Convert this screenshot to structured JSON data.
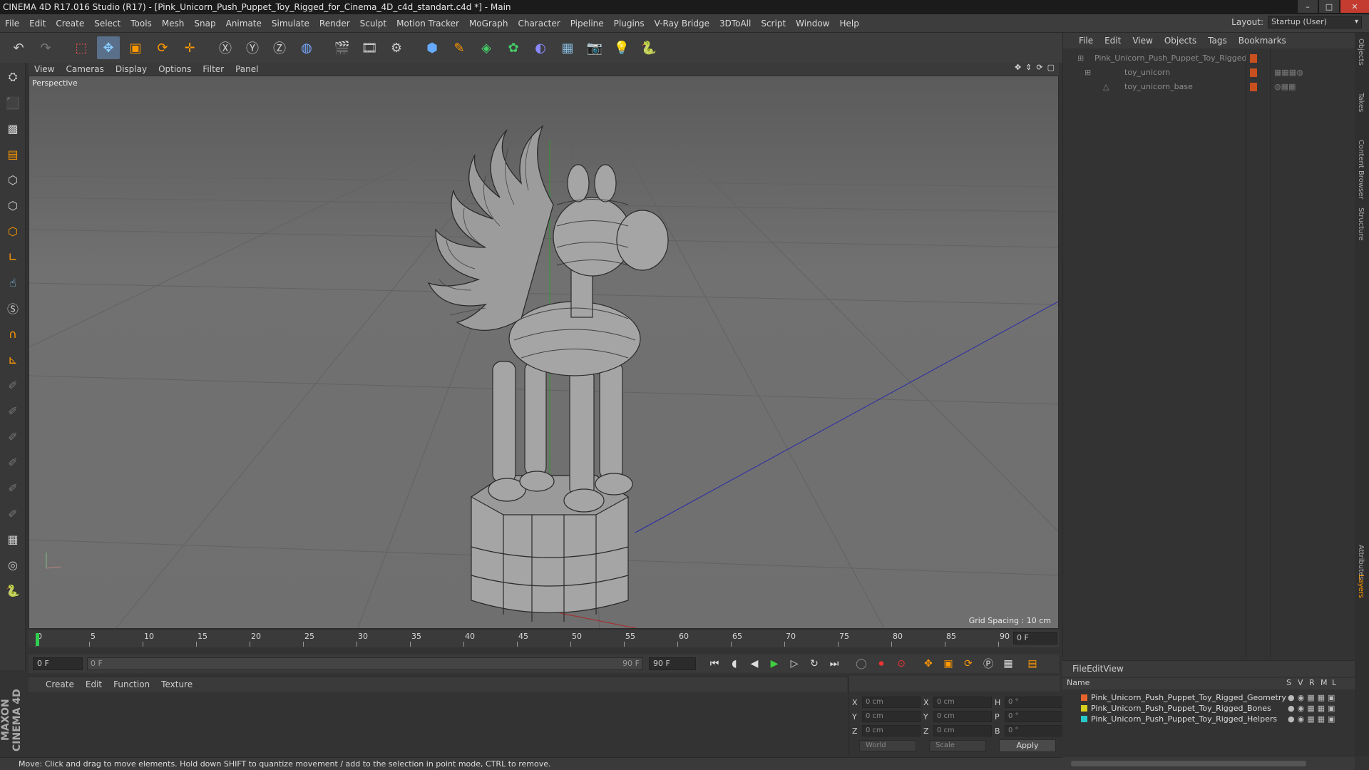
{
  "title": "CINEMA 4D R17.016 Studio (R17) - [Pink_Unicorn_Push_Puppet_Toy_Rigged_for_Cinema_4D_c4d_standart.c4d *] - Main",
  "menu": [
    "File",
    "Edit",
    "Create",
    "Select",
    "Tools",
    "Mesh",
    "Snap",
    "Animate",
    "Simulate",
    "Render",
    "Sculpt",
    "Motion Tracker",
    "MoGraph",
    "Character",
    "Pipeline",
    "Plugins",
    "V-Ray Bridge",
    "3DToAll",
    "Script",
    "Window",
    "Help"
  ],
  "layout_label": "Layout:",
  "layout_value": "Startup (User)",
  "viewport_menu": [
    "View",
    "Cameras",
    "Display",
    "Options",
    "Filter",
    "Panel"
  ],
  "viewport_label": "Perspective",
  "grid_spacing": "Grid Spacing : 10 cm",
  "timeline_ticks": [
    "0",
    "5",
    "10",
    "15",
    "20",
    "25",
    "30",
    "35",
    "40",
    "45",
    "50",
    "55",
    "60",
    "65",
    "70",
    "75",
    "80",
    "85",
    "90"
  ],
  "current_frame": "0 F",
  "start_frame": "0 F",
  "slider_start": "0 F",
  "slider_end": "90 F",
  "end_frame": "90 F",
  "material_menu": [
    "Create",
    "Edit",
    "Function",
    "Texture"
  ],
  "coords": {
    "col1": [
      {
        "label": "X",
        "value": "0 cm"
      },
      {
        "label": "Y",
        "value": "0 cm"
      },
      {
        "label": "Z",
        "value": "0 cm"
      }
    ],
    "col2": [
      {
        "label": "X",
        "value": "0 cm"
      },
      {
        "label": "Y",
        "value": "0 cm"
      },
      {
        "label": "Z",
        "value": "0 cm"
      }
    ],
    "col3": [
      {
        "label": "H",
        "value": "0 °"
      },
      {
        "label": "P",
        "value": "0 °"
      },
      {
        "label": "B",
        "value": "0 °"
      }
    ],
    "mode1": "World",
    "mode2": "Scale",
    "apply": "Apply"
  },
  "object_menu": [
    "File",
    "Edit",
    "View",
    "Objects",
    "Tags",
    "Bookmarks"
  ],
  "objects": [
    "Pink_Unicorn_Push_Puppet_Toy_Rigged",
    "toy_unicorn",
    "toy_unicorn_base"
  ],
  "layer_menu": [
    "File",
    "Edit",
    "View"
  ],
  "layer_header": {
    "name": "Name",
    "cols": [
      "S",
      "V",
      "R",
      "M",
      "L"
    ]
  },
  "layers": [
    {
      "name": "Pink_Unicorn_Push_Puppet_Toy_Rigged_Geometry",
      "color": "#e8632b"
    },
    {
      "name": "Pink_Unicorn_Push_Puppet_Toy_Rigged_Bones",
      "color": "#d8d020"
    },
    {
      "name": "Pink_Unicorn_Push_Puppet_Toy_Rigged_Helpers",
      "color": "#28c8c8"
    }
  ],
  "right_tabs": [
    "Objects",
    "Takes",
    "Content Browser",
    "Structure",
    "Attributes",
    "Layers"
  ],
  "status": "Move: Click and drag to move elements. Hold down SHIFT to quantize movement / add to the selection in point mode, CTRL to remove.",
  "brand": "MAXON CINEMA 4D"
}
